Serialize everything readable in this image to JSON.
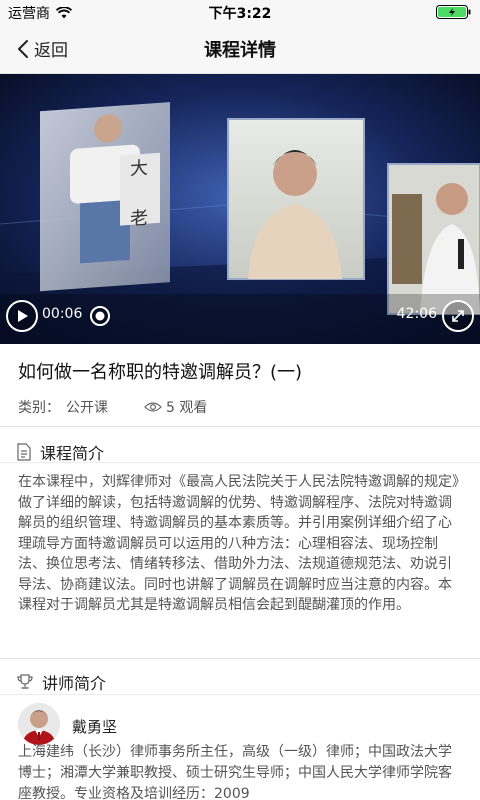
{
  "status_bar": {
    "carrier": "运营商",
    "time": "下午3:22"
  },
  "nav": {
    "back_label": "返回",
    "title": "课程详情"
  },
  "video": {
    "current_time": "00:06",
    "total_time": "42:06",
    "progress_fraction": 0.0024
  },
  "course": {
    "title": "如何做一名称职的特邀调解员？(一)",
    "category_label": "类别：",
    "category_value": "公开课",
    "views": "5 观看"
  },
  "intro": {
    "heading": "课程简介",
    "text": "在本课程中，刘辉律师对《最高人民法院关于人民法院特邀调解的规定》做了详细的解读，包括特邀调解的优势、特邀调解程序、法院对特邀调解员的组织管理、特邀调解员的基本素质等。并引用案例详细介绍了心理疏导方面特邀调解员可以运用的八种方法：心理相容法、现场控制法、换位思考法、情绪转移法、借助外力法、法规道德规范法、劝说引导法、协商建议法。同时也讲解了调解员在调解时应当注意的内容。本课程对于调解员尤其是特邀调解员相信会起到醍醐灌顶的作用。"
  },
  "teacher": {
    "heading": "讲师简介",
    "name": "戴勇坚",
    "bio": "上海建纬（长沙）律师事务所主任，高级（一级）律师；中国政法大学博士；湘潭大学兼职教授、硕士研究生导师；中国人民大学律师学院客座教授。专业资格及培训经历：2009"
  },
  "icons": {
    "back": "chevron-left-icon",
    "play": "play-icon",
    "fullscreen": "expand-icon",
    "views": "eye-icon",
    "intro": "document-icon",
    "teacher": "trophy-icon",
    "wifi": "wifi-icon",
    "battery": "battery-icon"
  },
  "colors": {
    "battery_fill": "#4cd964",
    "bar_bg": "#f7f7f7"
  }
}
